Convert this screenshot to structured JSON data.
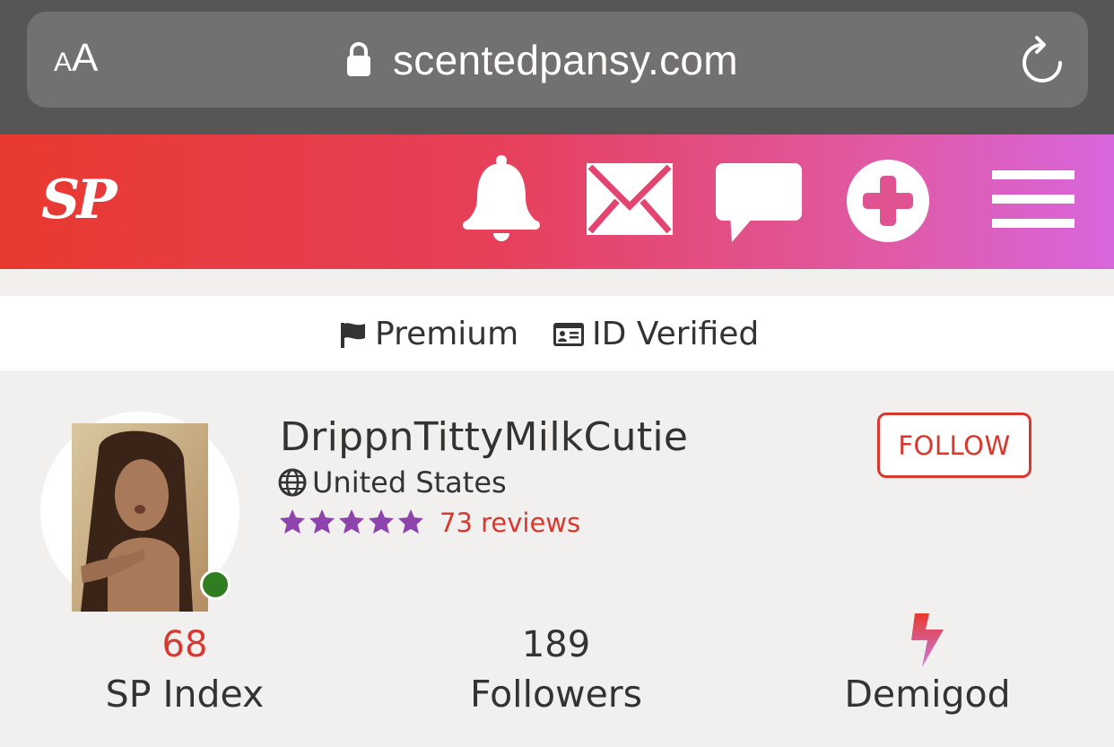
{
  "browser": {
    "text_size_small": "A",
    "text_size_large": "A",
    "url": "scentedpansy.com",
    "icons": [
      "lock-icon",
      "reload-icon"
    ]
  },
  "header": {
    "logo": "SP",
    "icons": [
      "bell-icon",
      "mail-icon",
      "chat-icon",
      "plus-circle-icon",
      "hamburger-menu-icon"
    ],
    "gradient_colors": [
      "#e8392f",
      "#e6405b",
      "#e05aa6",
      "#d866dd"
    ]
  },
  "badges": {
    "premium": "Premium",
    "verified": "ID Verified"
  },
  "profile": {
    "username": "DrippnTittyMilkCutie",
    "country": "United States",
    "rating_stars": 5,
    "reviews": "73 reviews",
    "follow_label": "FOLLOW",
    "online": true
  },
  "stats": {
    "sp_index_value": "68",
    "sp_index_label": "SP Index",
    "followers_value": "189",
    "followers_label": "Followers",
    "level_label": "Demigod"
  },
  "colors": {
    "accent_red": "#d8382e",
    "star_purple": "#8e44ad",
    "online_green": "#2f7d20",
    "page_bg": "#f2f0ef"
  }
}
